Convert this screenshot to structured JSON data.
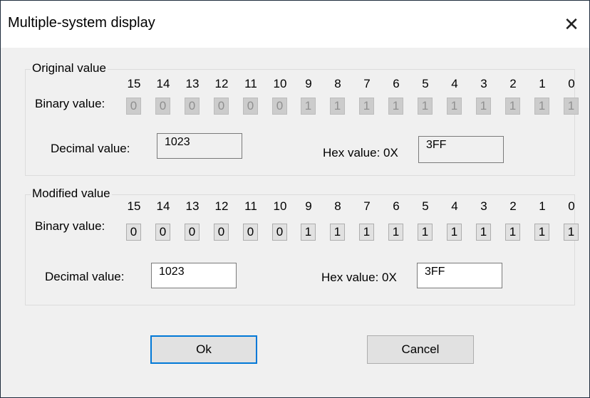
{
  "window": {
    "title": "Multiple-system display",
    "close_glyph": "✕"
  },
  "bit_indices": [
    "15",
    "14",
    "13",
    "12",
    "11",
    "10",
    "9",
    "8",
    "7",
    "6",
    "5",
    "4",
    "3",
    "2",
    "1",
    "0"
  ],
  "original": {
    "group_label": "Original value",
    "binary_label": "Binary value:",
    "bits": [
      "0",
      "0",
      "0",
      "0",
      "0",
      "0",
      "1",
      "1",
      "1",
      "1",
      "1",
      "1",
      "1",
      "1",
      "1",
      "1"
    ],
    "decimal_label": "Decimal value:",
    "decimal_value": "1023",
    "hex_label": "Hex value: 0X",
    "hex_value": "3FF"
  },
  "modified": {
    "group_label": "Modified value",
    "binary_label": "Binary value:",
    "bits": [
      "0",
      "0",
      "0",
      "0",
      "0",
      "0",
      "1",
      "1",
      "1",
      "1",
      "1",
      "1",
      "1",
      "1",
      "1",
      "1"
    ],
    "decimal_label": "Decimal value:",
    "decimal_value": "1023",
    "hex_label": "Hex value: 0X",
    "hex_value": "3FF"
  },
  "buttons": {
    "ok": "Ok",
    "cancel": "Cancel"
  }
}
